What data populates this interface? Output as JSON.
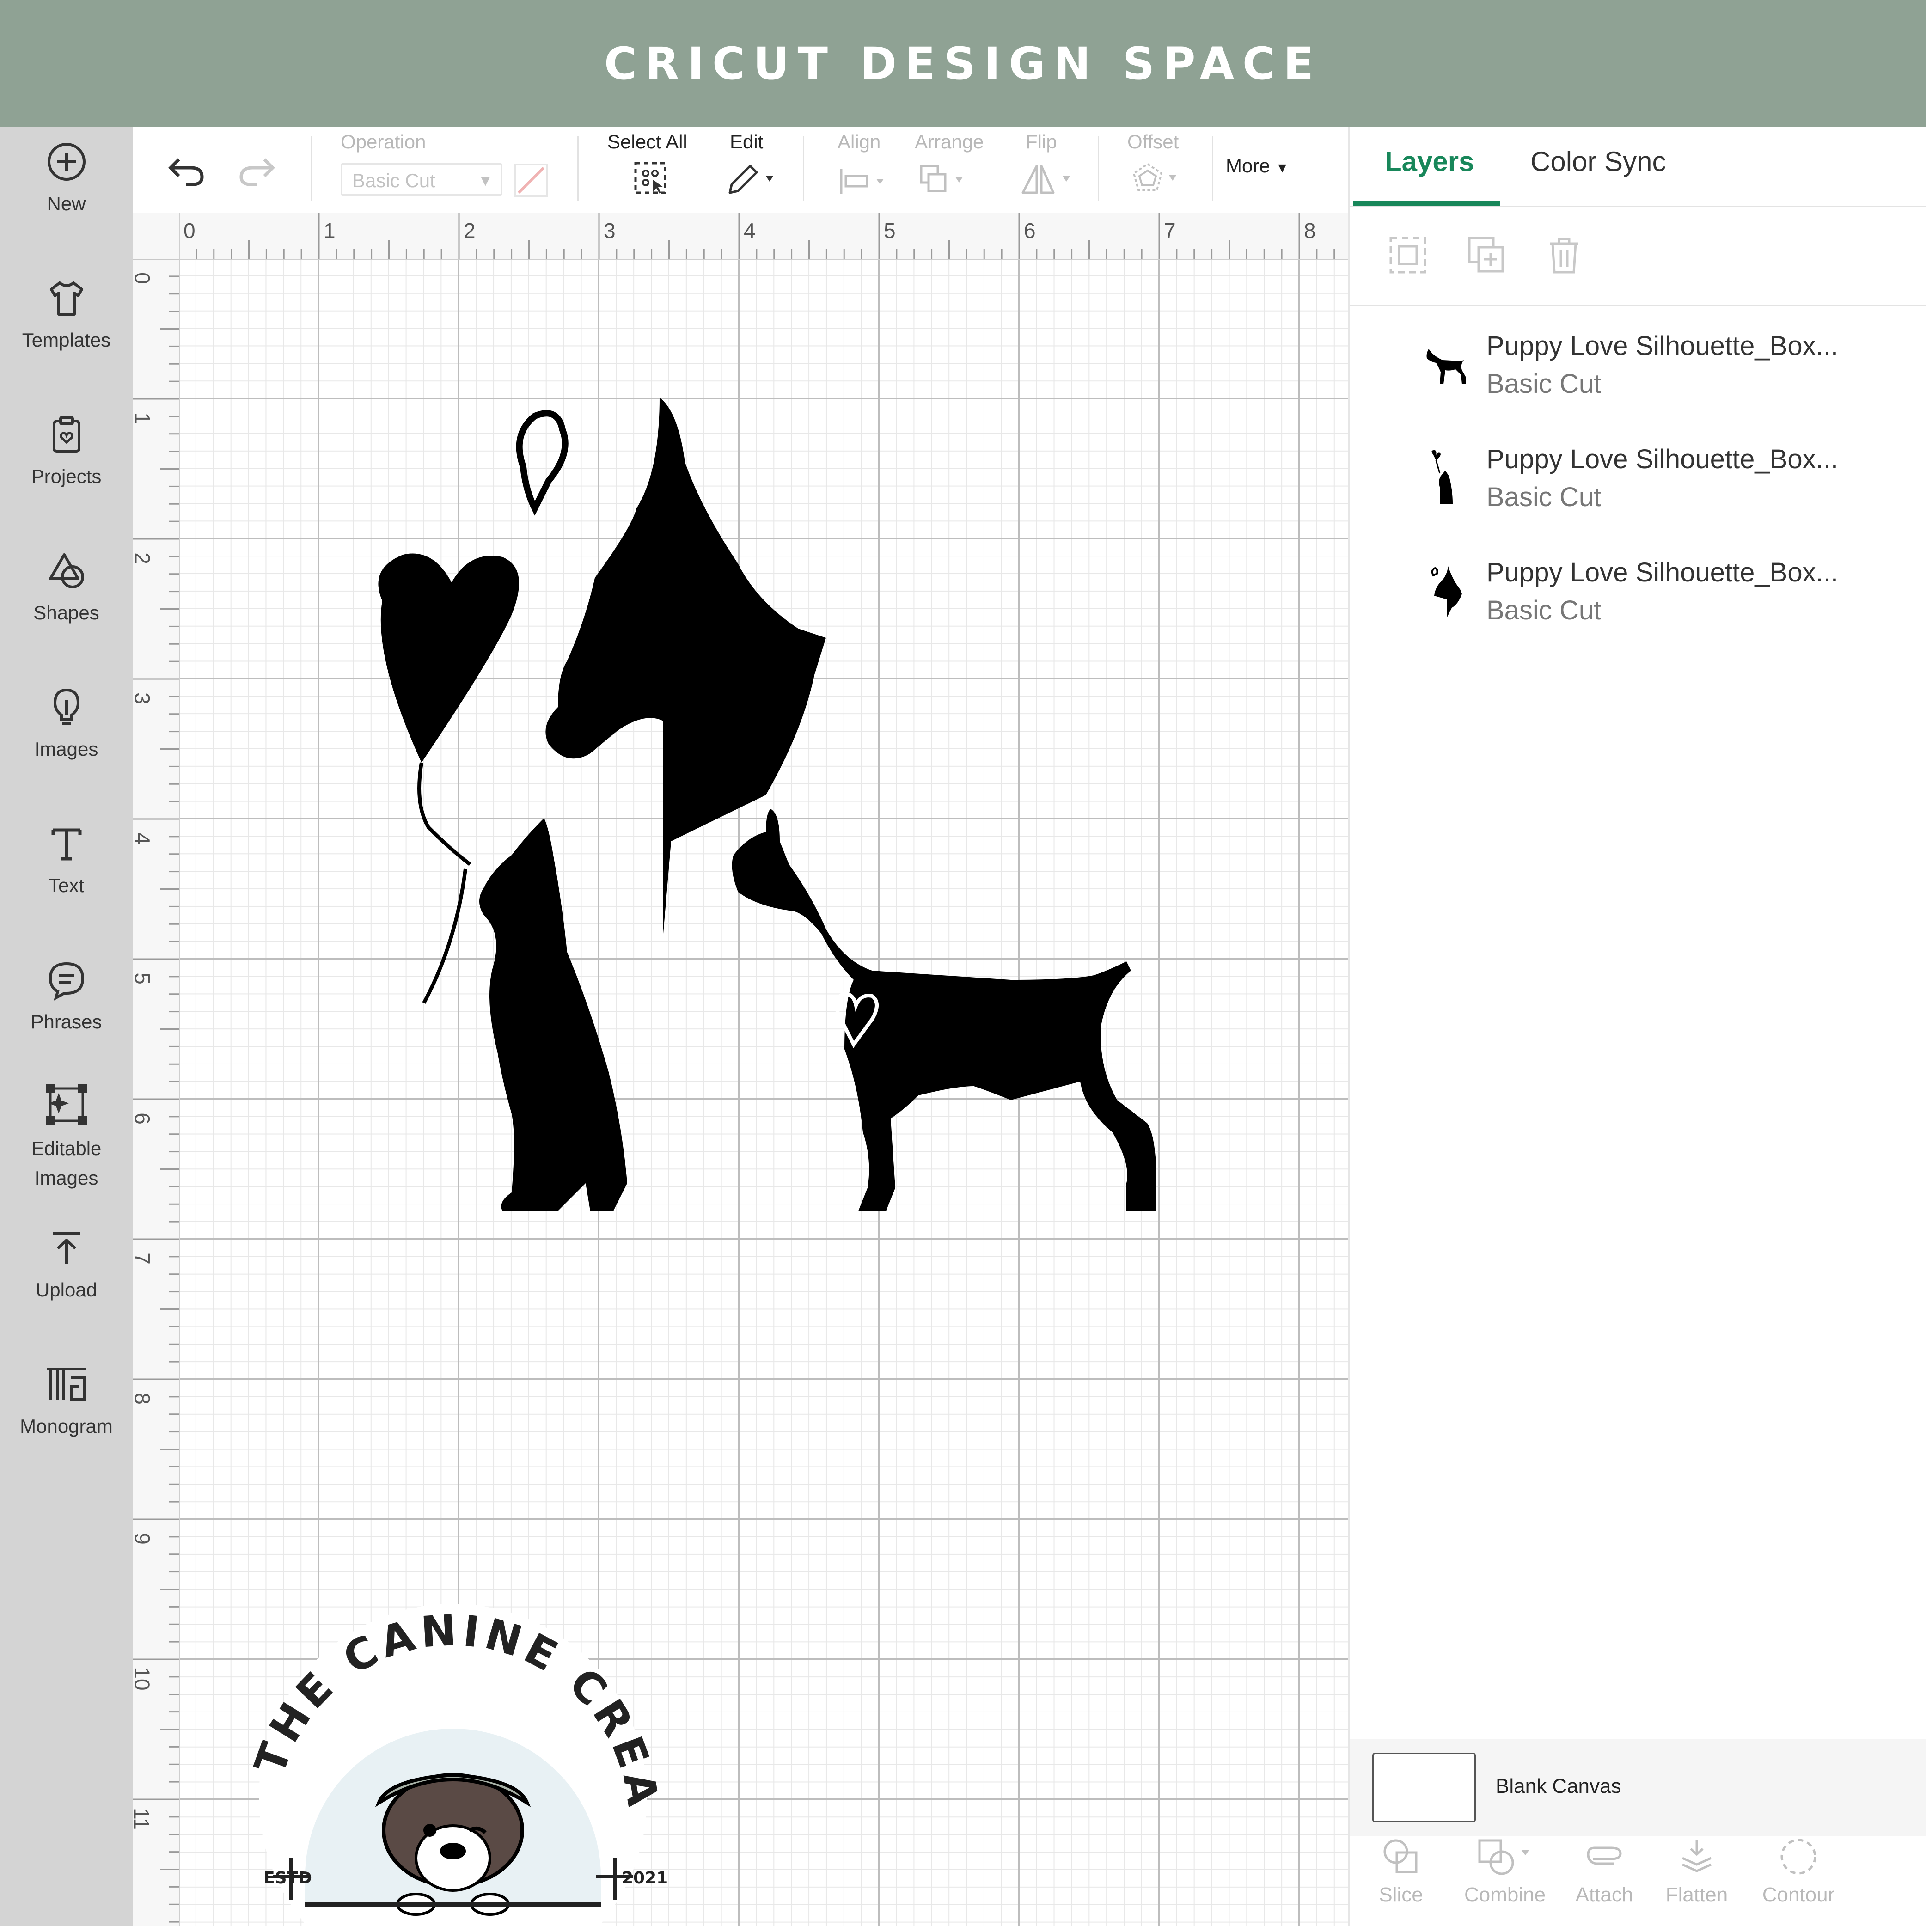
{
  "banner": {
    "title": "CRICUT DESIGN SPACE"
  },
  "sidebar": {
    "items": [
      {
        "label": "New",
        "icon": "plus-circle-icon"
      },
      {
        "label": "Templates",
        "icon": "tshirt-icon"
      },
      {
        "label": "Projects",
        "icon": "clipboard-icon"
      },
      {
        "label": "Shapes",
        "icon": "shapes-icon"
      },
      {
        "label": "Images",
        "icon": "bulb-icon"
      },
      {
        "label": "Text",
        "icon": "text-icon"
      },
      {
        "label": "Phrases",
        "icon": "speech-bubble-icon"
      },
      {
        "label": "Editable\nImages",
        "label_line1": "Editable",
        "label_line2": "Images",
        "icon": "editable-image-icon"
      },
      {
        "label": "Upload",
        "icon": "upload-icon"
      },
      {
        "label": "Monogram",
        "icon": "monogram-icon"
      }
    ]
  },
  "toolbar": {
    "operation_label": "Operation",
    "operation_value": "Basic Cut",
    "select_all_label": "Select All",
    "edit_label": "Edit",
    "align_label": "Align",
    "arrange_label": "Arrange",
    "flip_label": "Flip",
    "offset_label": "Offset",
    "more_label": "More"
  },
  "rulers": {
    "top": [
      "0",
      "1",
      "2",
      "3",
      "4",
      "5",
      "6",
      "7",
      "8"
    ],
    "left": [
      "0",
      "1",
      "2",
      "3",
      "4",
      "5",
      "6",
      "7",
      "8",
      "9",
      "10",
      "11"
    ]
  },
  "panel": {
    "tabs": [
      {
        "label": "Layers",
        "active": true
      },
      {
        "label": "Color Sync",
        "active": false
      }
    ],
    "layers": [
      {
        "name": "Puppy Love Silhouette_Box...",
        "operation": "Basic Cut"
      },
      {
        "name": "Puppy Love Silhouette_Box...",
        "operation": "Basic Cut"
      },
      {
        "name": "Puppy Love Silhouette_Box...",
        "operation": "Basic Cut"
      }
    ],
    "blank_canvas_label": "Blank Canvas",
    "bottom_tools": [
      "Slice",
      "Combine",
      "Attach",
      "Flatten",
      "Contour"
    ]
  },
  "logo": {
    "text": "THE CANINE CREATIVE",
    "estd": "ESTD",
    "year": "2021"
  },
  "colors": {
    "accent": "#18875a",
    "banner": "#8fa294",
    "sidebar": "#d4d4d4"
  }
}
